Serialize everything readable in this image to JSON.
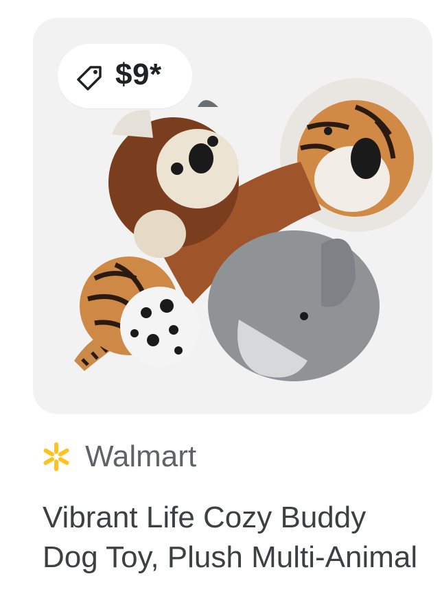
{
  "product": {
    "price": "$9*",
    "merchant": "Walmart",
    "title": "Vibrant Life Cozy Buddy Dog Toy, Plush Multi-Animal"
  },
  "icons": {
    "price_tag": "tag-icon",
    "merchant_logo": "walmart-spark-icon"
  },
  "colors": {
    "card_background": "#f2f2f2",
    "walmart_spark": "#ffc220",
    "text_primary": "#3c4043",
    "text_secondary": "#5f6368"
  }
}
